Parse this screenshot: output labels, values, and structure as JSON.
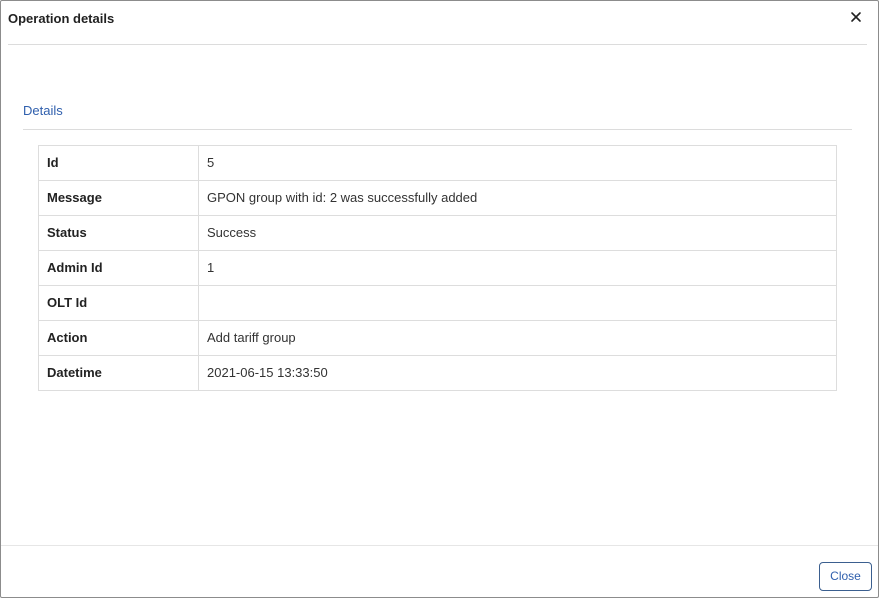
{
  "dialog": {
    "title": "Operation details",
    "close_icon": "close-icon"
  },
  "tabs": [
    {
      "label": "Details"
    }
  ],
  "details": {
    "rows": [
      {
        "label": "Id",
        "value": "5"
      },
      {
        "label": "Message",
        "value": "GPON group with id: 2 was successfully added"
      },
      {
        "label": "Status",
        "value": "Success"
      },
      {
        "label": "Admin Id",
        "value": "1"
      },
      {
        "label": "OLT Id",
        "value": ""
      },
      {
        "label": "Action",
        "value": "Add tariff group"
      },
      {
        "label": "Datetime",
        "value": "2021-06-15 13:33:50"
      }
    ]
  },
  "footer": {
    "close_label": "Close"
  },
  "colors": {
    "accent": "#2f5fad",
    "border": "#dddddd"
  }
}
